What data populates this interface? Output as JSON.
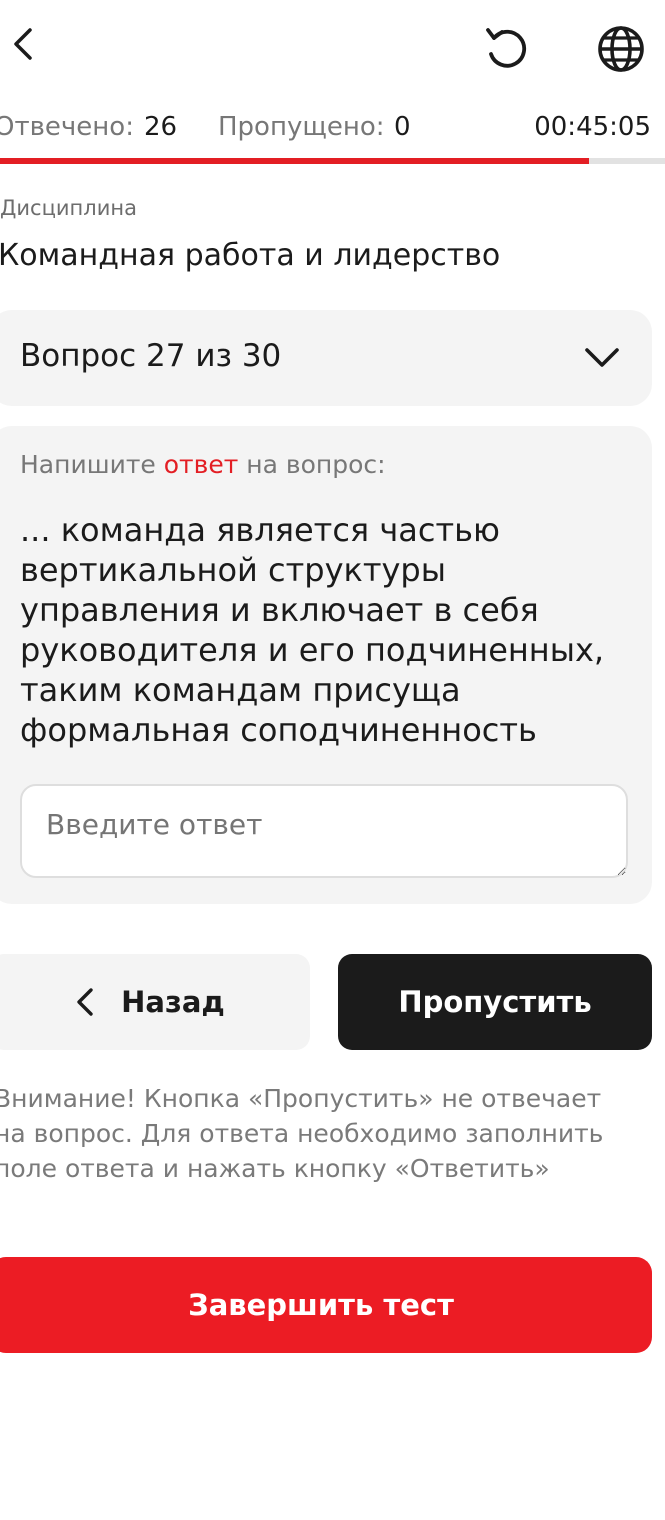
{
  "header": {
    "back_icon": "chevron-left-icon",
    "reset_icon": "rotate-ccw-icon",
    "language_icon": "globe-icon"
  },
  "stats": {
    "answered_label": "Отвечено:",
    "answered_value": "26",
    "skipped_label": "Пропущено:",
    "skipped_value": "0",
    "timer": "00:45:05",
    "progress_fraction": 0.885
  },
  "discipline": {
    "label": "Дисциплина",
    "name": "Командная работа и лидерство"
  },
  "question_selector": {
    "label": "Вопрос 27 из 30"
  },
  "question": {
    "prompt_before": "Напишите ",
    "prompt_highlight": "ответ",
    "prompt_after": " на вопрос:",
    "text": "... команда является частью вертикальной структуры управления и включает в себя руководителя и его подчиненных, таким командам присуща формальная соподчиненность",
    "answer_placeholder": "Введите ответ"
  },
  "actions": {
    "back_label": "Назад",
    "skip_label": "Пропустить",
    "warning": "Внимание! Кнопка «Пропустить» не отвечает на вопрос. Для ответа необходимо заполнить поле ответа и нажать кнопку «Ответить»",
    "finish_label": "Завершить тест"
  },
  "colors": {
    "accent": "#e31e24",
    "dark_button": "#1b1b1b",
    "card_bg": "#f4f4f4"
  }
}
